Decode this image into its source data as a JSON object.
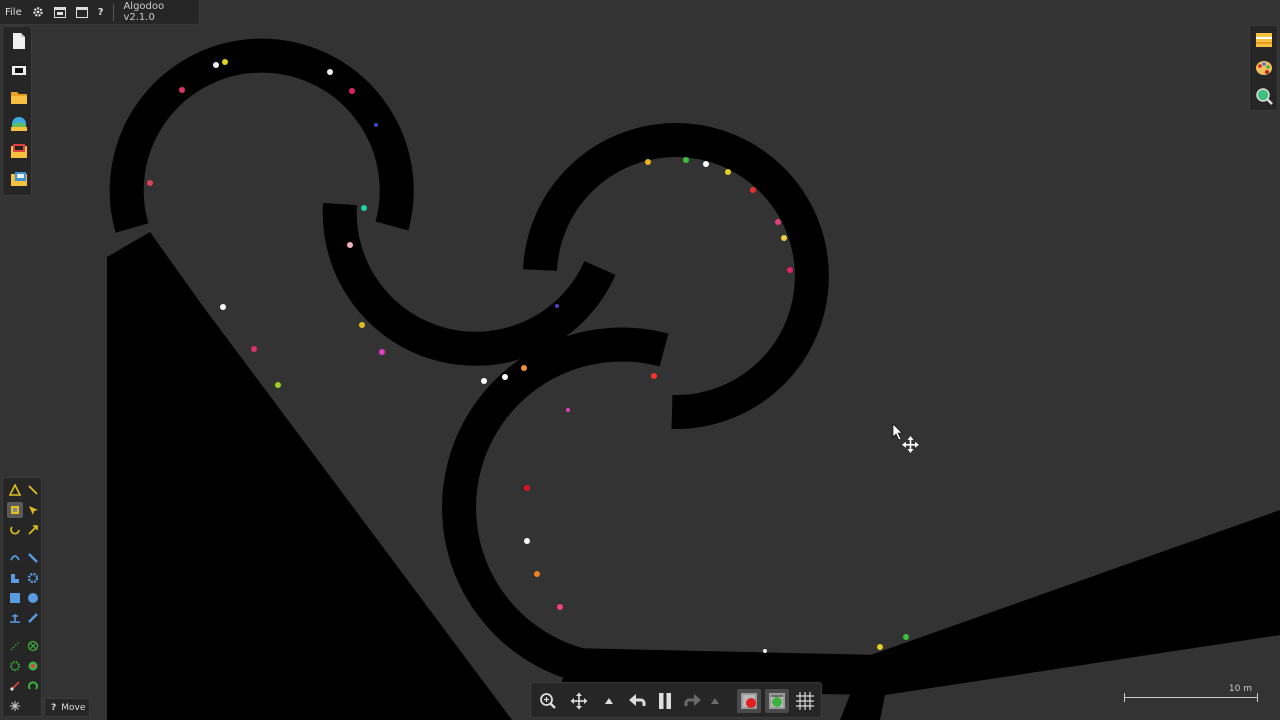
{
  "menubar": {
    "file_label": "File",
    "settings_icon": "gear-icon",
    "window_icon": "window-icon",
    "panel_icon": "panel-icon",
    "help_label": "?",
    "app_title": "Algodoo v2.1.0"
  },
  "left_toolbar": {
    "items": [
      "new-scene-icon",
      "blank-scene-icon",
      "open-folder-icon",
      "browse-online-icon",
      "phunlets-icon",
      "save-folder-icon"
    ]
  },
  "tools_panel": {
    "active_tool": "move",
    "tools": [
      "sketch",
      "cut",
      "move",
      "drag",
      "rotate",
      "scale",
      "rope",
      "spring",
      "plane",
      "gear",
      "box",
      "circle",
      "fixate",
      "hinge",
      "tracer",
      "thruster",
      "laser",
      "chain",
      "brush",
      "knife"
    ]
  },
  "bottom_hint": {
    "help": "?",
    "tool_name": "Move"
  },
  "bottom_bar": {
    "buttons": [
      "zoom-icon",
      "pan-icon",
      "undo-menu-icon",
      "undo-icon",
      "pause-icon",
      "redo-icon",
      "redo-menu-icon",
      "gravity-icon",
      "air-icon",
      "grid-icon"
    ]
  },
  "right_toolbar": {
    "items": [
      "options-icon",
      "palette-icon",
      "find-icon"
    ]
  },
  "scale_bar": {
    "label": "10 m"
  },
  "colors": {
    "background": "#333333",
    "solid": "#000000",
    "panel": "#262626",
    "accent": "#e0c020"
  }
}
